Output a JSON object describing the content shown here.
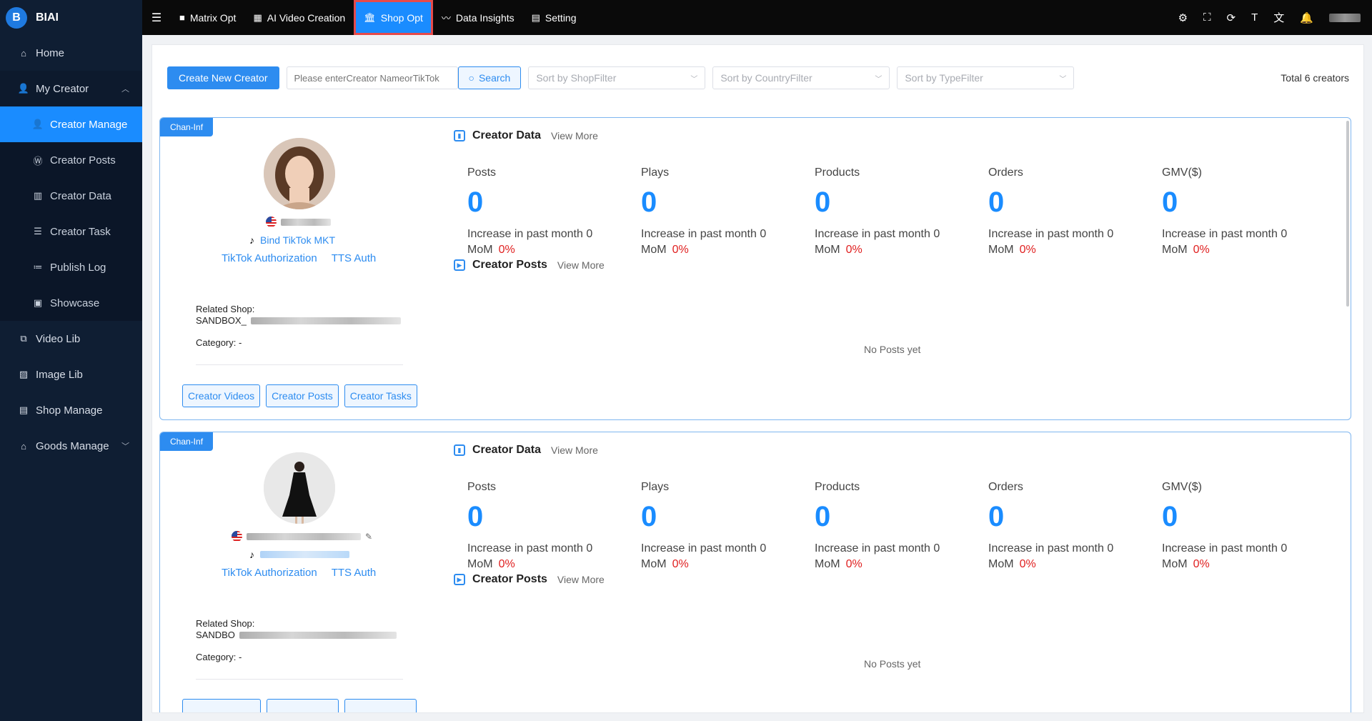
{
  "brand": {
    "logo_letter": "B",
    "name": "BIAI"
  },
  "sidebar": {
    "items": [
      {
        "label": "Home",
        "icon": "home-icon"
      },
      {
        "label": "My Creator",
        "icon": "user-icon"
      },
      {
        "label": "Creator Manage",
        "icon": "user-icon"
      },
      {
        "label": "Creator Posts",
        "icon": "wordpress-icon"
      },
      {
        "label": "Creator Data",
        "icon": "bar-chart-icon"
      },
      {
        "label": "Creator Task",
        "icon": "task-icon"
      },
      {
        "label": "Publish Log",
        "icon": "list-icon"
      },
      {
        "label": "Showcase",
        "icon": "bag-icon"
      },
      {
        "label": "Video Lib",
        "icon": "video-lib-icon"
      },
      {
        "label": "Image Lib",
        "icon": "image-icon"
      },
      {
        "label": "Shop Manage",
        "icon": "shop-icon"
      },
      {
        "label": "Goods Manage",
        "icon": "goods-icon"
      }
    ]
  },
  "topbar": {
    "tabs": [
      {
        "label": "Matrix Opt",
        "icon": "video-camera-icon"
      },
      {
        "label": "AI Video Creation",
        "icon": "grid-icon"
      },
      {
        "label": "Shop Opt",
        "icon": "bank-icon"
      },
      {
        "label": "Data Insights",
        "icon": "insights-icon"
      },
      {
        "label": "Setting",
        "icon": "document-icon"
      }
    ]
  },
  "toolbar": {
    "create_label": "Create New Creator",
    "search_placeholder": "Please enterCreator NameorTikTok",
    "search_label": "Search",
    "filter_shop": "Sort by ShopFilter",
    "filter_country": "Sort by CountryFilter",
    "filter_type": "Sort by TypeFilter",
    "total": "Total 6 creators"
  },
  "cards": [
    {
      "tag": "Chan-Inf",
      "bind_link": "Bind TikTok MKT",
      "auth_tiktok": "TikTok Authorization",
      "auth_tts": "TTS Auth",
      "related_shop_label": "Related Shop:",
      "related_shop_value": "SANDBOX_",
      "category_label": "Category:",
      "category_value": "-",
      "buttons": [
        "Creator Videos",
        "Creator Posts",
        "Creator Tasks"
      ],
      "data_title": "Creator Data",
      "view_more": "View More",
      "posts_title": "Creator Posts",
      "no_posts": "No Posts yet",
      "stats": [
        {
          "label": "Posts",
          "value": "0",
          "inc": "Increase in past month 0",
          "mom": "MoM",
          "pct": "0%"
        },
        {
          "label": "Plays",
          "value": "0",
          "inc": "Increase in past month 0",
          "mom": "MoM",
          "pct": "0%"
        },
        {
          "label": "Products",
          "value": "0",
          "inc": "Increase in past month 0",
          "mom": "MoM",
          "pct": "0%"
        },
        {
          "label": "Orders",
          "value": "0",
          "inc": "Increase in past month 0",
          "mom": "MoM",
          "pct": "0%"
        },
        {
          "label": "GMV($)",
          "value": "0",
          "inc": "Increase in past month 0",
          "mom": "MoM",
          "pct": "0%"
        }
      ]
    },
    {
      "tag": "Chan-Inf",
      "bind_link": "",
      "auth_tiktok": "TikTok Authorization",
      "auth_tts": "TTS Auth",
      "related_shop_label": "Related Shop:",
      "related_shop_value": "SANDBO",
      "category_label": "Category:",
      "category_value": "-",
      "data_title": "Creator Data",
      "view_more": "View More",
      "posts_title": "Creator Posts",
      "no_posts": "No Posts yet",
      "stats": [
        {
          "label": "Posts",
          "value": "0",
          "inc": "Increase in past month 0",
          "mom": "MoM",
          "pct": "0%"
        },
        {
          "label": "Plays",
          "value": "0",
          "inc": "Increase in past month 0",
          "mom": "MoM",
          "pct": "0%"
        },
        {
          "label": "Products",
          "value": "0",
          "inc": "Increase in past month 0",
          "mom": "MoM",
          "pct": "0%"
        },
        {
          "label": "Orders",
          "value": "0",
          "inc": "Increase in past month 0",
          "mom": "MoM",
          "pct": "0%"
        },
        {
          "label": "GMV($)",
          "value": "0",
          "inc": "Increase in past month 0",
          "mom": "MoM",
          "pct": "0%"
        }
      ]
    }
  ],
  "colors": {
    "accent": "#1a8cff",
    "sidebar_bg": "#0f1e33",
    "topbar_bg": "#0a0a0a",
    "danger": "#e02020",
    "highlight_outline": "#e64a4a"
  }
}
